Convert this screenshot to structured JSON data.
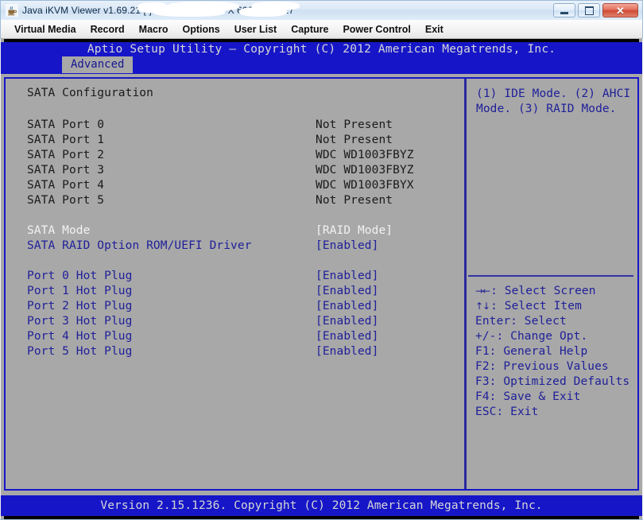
{
  "window": {
    "title": "Java iKVM Viewer v1.69.21 [                                       ] - Resolution 800 X 600 - FPS 17",
    "icon": "java-coffee-cup-icon",
    "buttons": {
      "minimize": "minimize-icon",
      "maximize": "maximize-icon",
      "close": "✕"
    }
  },
  "menu": {
    "items": [
      {
        "label": "Virtual Media"
      },
      {
        "label": "Record"
      },
      {
        "label": "Macro"
      },
      {
        "label": "Options"
      },
      {
        "label": "User List"
      },
      {
        "label": "Capture"
      },
      {
        "label": "Power Control"
      },
      {
        "label": "Exit"
      }
    ]
  },
  "bios": {
    "header_title": "Aptio Setup Utility – Copyright (C) 2012 American Megatrends, Inc.",
    "active_tab": "Advanced",
    "section_title": "SATA Configuration",
    "rows": [
      {
        "label": "SATA Port 0",
        "value": "Not Present"
      },
      {
        "label": "SATA Port 1",
        "value": "Not Present"
      },
      {
        "label": "SATA Port 2",
        "value": "WDC WD1003FBYZ"
      },
      {
        "label": "SATA Port 3",
        "value": "WDC WD1003FBYZ"
      },
      {
        "label": "SATA Port 4",
        "value": "WDC WD1003FBYX"
      },
      {
        "label": "SATA Port 5",
        "value": "Not Present"
      },
      {
        "label": "SATA Mode",
        "value": "[RAID Mode]"
      },
      {
        "label": "SATA RAID Option ROM/UEFI Driver",
        "value": "[Enabled]"
      },
      {
        "label": "Port 0 Hot Plug",
        "value": "[Enabled]"
      },
      {
        "label": "Port 1 Hot Plug",
        "value": "[Enabled]"
      },
      {
        "label": "Port 2 Hot Plug",
        "value": "[Enabled]"
      },
      {
        "label": "Port 3 Hot Plug",
        "value": "[Enabled]"
      },
      {
        "label": "Port 4 Hot Plug",
        "value": "[Enabled]"
      },
      {
        "label": "Port 5 Hot Plug",
        "value": "[Enabled]"
      }
    ],
    "help_text": "(1) IDE Mode. (2) AHCI Mode. (3) RAID Mode.",
    "legend": [
      {
        "keys": "→←",
        "action": ": Select Screen"
      },
      {
        "keys": "↑↓",
        "action": ": Select Item"
      },
      {
        "keys": "",
        "action": "Enter: Select"
      },
      {
        "keys": "",
        "action": "+/-: Change Opt."
      },
      {
        "keys": "",
        "action": "F1: General Help"
      },
      {
        "keys": "",
        "action": "F2: Previous Values"
      },
      {
        "keys": "",
        "action": "F3: Optimized Defaults"
      },
      {
        "keys": "",
        "action": "F4: Save & Exit"
      },
      {
        "keys": "",
        "action": "ESC: Exit"
      }
    ],
    "footer": "Version 2.15.1236. Copyright (C) 2012 American Megatrends, Inc."
  },
  "colors": {
    "bios_blue": "#1616c8",
    "bios_gray": "#a8a8a8",
    "item_blue": "#20209a",
    "selected_white": "#f2f2f2",
    "close_red": "#cf4a34"
  }
}
